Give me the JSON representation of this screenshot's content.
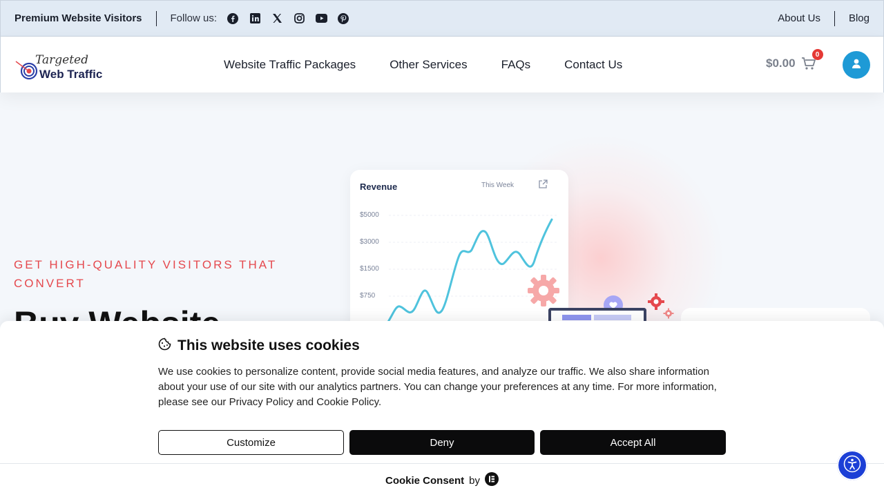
{
  "topbar": {
    "brand": "Premium Website Visitors",
    "follow_label": "Follow us:",
    "social_icons": [
      "facebook-icon",
      "linkedin-icon",
      "x-icon",
      "instagram-icon",
      "youtube-icon",
      "pinterest-icon"
    ],
    "links": [
      {
        "label": "About Us"
      },
      {
        "label": "Blog"
      }
    ]
  },
  "header": {
    "logo_text_top": "Targeted",
    "logo_text_bottom": "Web Traffic",
    "nav": [
      {
        "label": "Website Traffic Packages"
      },
      {
        "label": "Other Services"
      },
      {
        "label": "FAQs"
      },
      {
        "label": "Contact Us"
      }
    ],
    "cart_total": "$0.00",
    "cart_count": "0"
  },
  "hero": {
    "eyebrow": "GET HIGH-QUALITY VISITORS THAT CONVERT",
    "title": "Buy Website",
    "card": {
      "title": "Revenue",
      "period": "This Week",
      "ticks": [
        "$5000",
        "$3000",
        "$1500",
        "$750"
      ]
    }
  },
  "cookie": {
    "title": "This website uses cookies",
    "body": "We use cookies to personalize content, provide social media features, and analyze our traffic. We also share information about your use of our site with our analytics partners. You can change your preferences at any time. For more information, please see our Privacy Policy and Cookie Policy.",
    "buttons": {
      "customize": "Customize",
      "deny": "Deny",
      "accept": "Accept All"
    },
    "footer_brand": "Cookie Consent",
    "footer_by": "by"
  },
  "colors": {
    "accent_red": "#e5484d",
    "primary_blue": "#1e9ad6",
    "accessibility_blue": "#1c3fd6",
    "chart_line": "#4fc3dd"
  }
}
